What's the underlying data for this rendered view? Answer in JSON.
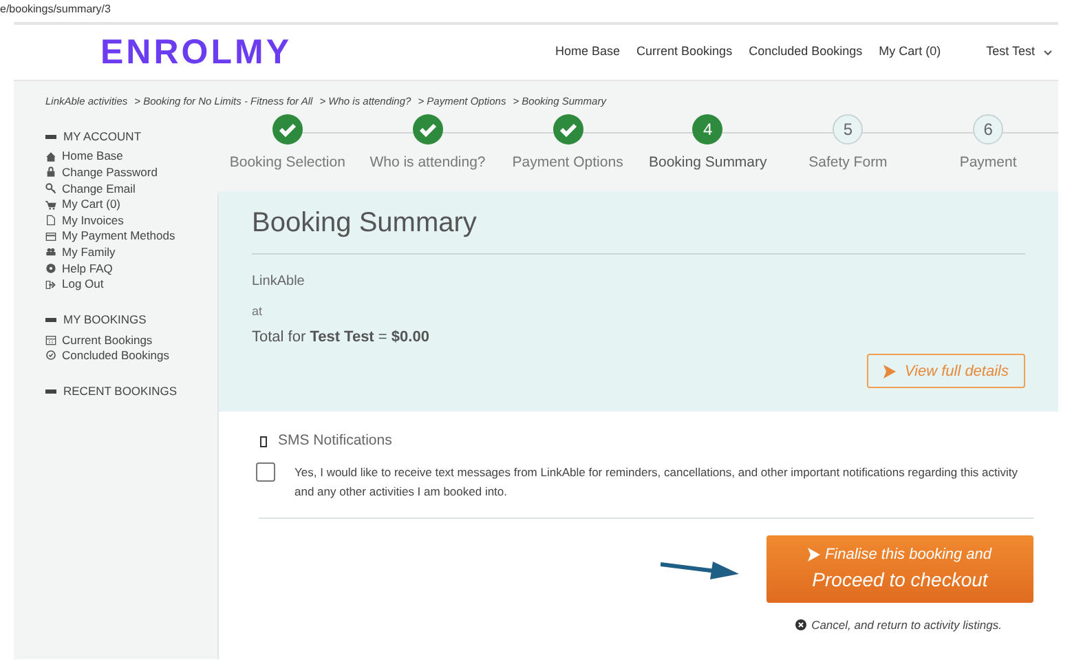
{
  "url": "e/bookings/summary/3",
  "logo": "ENROLMY",
  "nav": [
    "Home Base",
    "Current Bookings",
    "Concluded Bookings",
    "My Cart (0)"
  ],
  "user_menu": "Test Test",
  "breadcrumb": [
    "LinkAble activities",
    "> Booking for No Limits - Fitness for All",
    "> Who is attending?",
    "> Payment Options",
    "> Booking Summary"
  ],
  "sidebar": [
    {
      "heading": "MY ACCOUNT",
      "items": [
        "Home Base",
        "Change Password",
        "Change Email",
        "My Cart (0)",
        "My Invoices",
        "My Payment Methods",
        "My Family",
        "Help FAQ",
        "Log Out"
      ]
    },
    {
      "heading": "MY BOOKINGS",
      "items": [
        "Current Bookings",
        "Concluded Bookings"
      ]
    },
    {
      "heading": "RECENT BOOKINGS"
    }
  ],
  "steps": [
    {
      "label": "Booking Selection",
      "completed": true,
      "current": false
    },
    {
      "label": "Who is attending?",
      "completed": true,
      "current": false
    },
    {
      "label": "Payment Options",
      "completed": true,
      "current": false
    },
    {
      "number": "4",
      "label": "Booking Summary",
      "completed": false,
      "current": true
    },
    {
      "number": "5",
      "label": "Safety Form",
      "completed": false,
      "current": false
    },
    {
      "number": "6",
      "label": "Payment",
      "completed": false,
      "current": false
    }
  ],
  "summary": {
    "title": "Booking Summary",
    "provider": "LinkAble",
    "at": "at",
    "total": "Total for **Test Test** = **$0.00**",
    "details_button": "View full details"
  },
  "sms": {
    "title": "SMS Notifications",
    "checked": false,
    "text": "Yes, I would like to receive text messages from LinkAble for reminders, cancellations, and other important notifications regarding this activity and any other activities I am booked into."
  },
  "checkout_button": {
    "line_1": "Finalise this booking and",
    "line_2": "Proceed to checkout"
  },
  "cancel_link": "Cancel, and return to activity listings."
}
